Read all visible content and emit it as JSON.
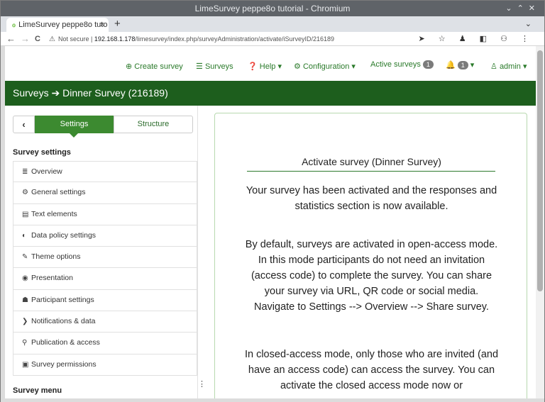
{
  "window": {
    "title": "LimeSurvey peppe8o tutorial - Chromium",
    "controls": [
      "⌄",
      "⌃",
      "✕"
    ]
  },
  "browser": {
    "tab_title": "LimeSurvey peppe8o tuto",
    "tab_close": "×",
    "new_tab": "+",
    "tab_dropdown": "⌄",
    "nav": {
      "back": "←",
      "forward": "→",
      "reload": "C"
    },
    "security_label": "Not secure",
    "url_host": "192.168.1.178",
    "url_path": "/limesurvey/index.php/surveyAdministration/activate/iSurveyID/216189",
    "toolbar_icons": "➤ ☆ ♟ ◧ ⚇ ⋮"
  },
  "topnav": {
    "create_survey": "Create survey",
    "surveys": "Surveys",
    "help": "Help",
    "configuration": "Configuration",
    "active_surveys": "Active surveys",
    "active_surveys_count": "1",
    "notifications_count": "1",
    "admin": "admin"
  },
  "breadcrumb": {
    "root": "Surveys",
    "current": "Dinner Survey (216189)"
  },
  "sidebar": {
    "tab_settings": "Settings",
    "tab_structure": "Structure",
    "section_settings": "Survey settings",
    "items": [
      {
        "label": "Overview",
        "icon": "≣"
      },
      {
        "label": "General settings",
        "icon": "⚙"
      },
      {
        "label": "Text elements",
        "icon": "▤"
      },
      {
        "label": "Data policy settings",
        "icon": "◐"
      },
      {
        "label": "Theme options",
        "icon": "✎"
      },
      {
        "label": "Presentation",
        "icon": "◉"
      },
      {
        "label": "Participant settings",
        "icon": "☗"
      },
      {
        "label": "Notifications & data",
        "icon": "❯"
      },
      {
        "label": "Publication & access",
        "icon": "⚲"
      },
      {
        "label": "Survey permissions",
        "icon": "▣"
      }
    ],
    "section_menu": "Survey menu"
  },
  "main": {
    "heading": "Activate survey (Dinner Survey)",
    "para1": "Your survey has been activated and the responses and statistics section is now available.",
    "para2": "By default, surveys are activated in open-access mode. In this mode participants do not need an invitation (access code) to complete the survey. You can share your survey via URL, QR code or social media. Navigate to Settings --> Overview --> Share survey.",
    "para3": "In closed-access mode, only those who are invited (and have an access code) can access the survey. You can activate the closed access mode now or"
  }
}
